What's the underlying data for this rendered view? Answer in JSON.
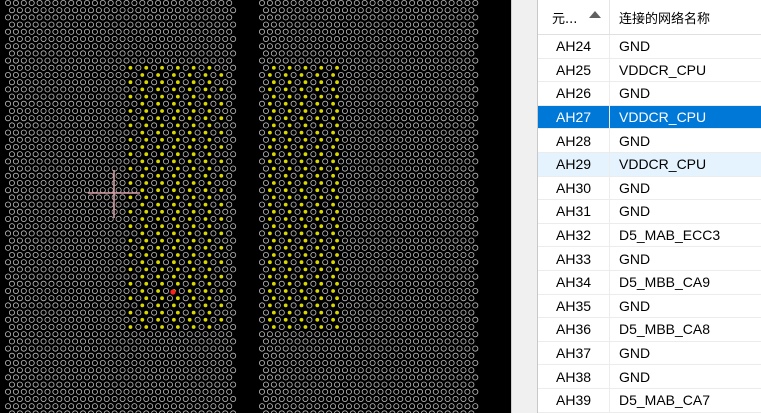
{
  "table": {
    "header_pin": "元...",
    "header_net": "连接的网络名称",
    "rows": [
      {
        "pin": "AH24",
        "net": "GND",
        "state": ""
      },
      {
        "pin": "AH25",
        "net": "VDDCR_CPU",
        "state": ""
      },
      {
        "pin": "AH26",
        "net": "GND",
        "state": ""
      },
      {
        "pin": "AH27",
        "net": "VDDCR_CPU",
        "state": "sel"
      },
      {
        "pin": "AH28",
        "net": "GND",
        "state": ""
      },
      {
        "pin": "AH29",
        "net": "VDDCR_CPU",
        "state": "hover"
      },
      {
        "pin": "AH30",
        "net": "GND",
        "state": ""
      },
      {
        "pin": "AH31",
        "net": "GND",
        "state": ""
      },
      {
        "pin": "AH32",
        "net": "D5_MAB_ECC3",
        "state": ""
      },
      {
        "pin": "AH33",
        "net": "GND",
        "state": ""
      },
      {
        "pin": "AH34",
        "net": "D5_MBB_CA9",
        "state": ""
      },
      {
        "pin": "AH35",
        "net": "GND",
        "state": ""
      },
      {
        "pin": "AH36",
        "net": "D5_MBB_CA8",
        "state": ""
      },
      {
        "pin": "AH37",
        "net": "GND",
        "state": ""
      },
      {
        "pin": "AH38",
        "net": "GND",
        "state": ""
      },
      {
        "pin": "AH39",
        "net": "D5_MAB_CA7",
        "state": ""
      }
    ]
  },
  "colors": {
    "selected_row": "#0078d7",
    "hover_row": "#e5f3ff",
    "pad_outline": "#bfbfbf",
    "highlight_pad": "#d8d800",
    "cursor": "#d8a0a8"
  }
}
